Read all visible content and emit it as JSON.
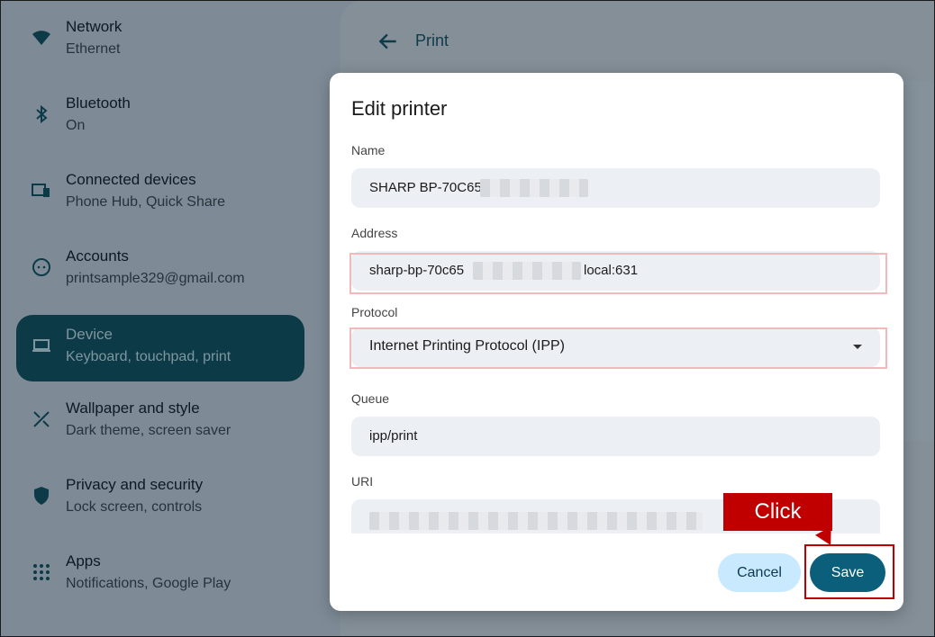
{
  "sidebar": {
    "items": [
      {
        "title": "Network",
        "subtitle": "Ethernet",
        "icon": "wifi-icon"
      },
      {
        "title": "Bluetooth",
        "subtitle": "On",
        "icon": "bluetooth-icon"
      },
      {
        "title": "Connected devices",
        "subtitle": "Phone Hub, Quick Share",
        "icon": "connected-devices-icon"
      },
      {
        "title": "Accounts",
        "subtitle": "printsample329@gmail.com",
        "icon": "account-icon"
      },
      {
        "title": "Device",
        "subtitle": "Keyboard, touchpad, print",
        "icon": "laptop-icon",
        "active": true
      },
      {
        "title": "Wallpaper and style",
        "subtitle": "Dark theme, screen saver",
        "icon": "palette-icon"
      },
      {
        "title": "Privacy and security",
        "subtitle": "Lock screen, controls",
        "icon": "shield-icon"
      },
      {
        "title": "Apps",
        "subtitle": "Notifications, Google Play",
        "icon": "apps-grid-icon"
      }
    ]
  },
  "main": {
    "title": "Print",
    "back_icon": "back-arrow-icon"
  },
  "dialog": {
    "title": "Edit printer",
    "name": {
      "label": "Name",
      "value": "SHARP BP-70C65"
    },
    "address": {
      "label": "Address",
      "value_prefix": "sharp-bp-70c65",
      "value_suffix": "local:631"
    },
    "protocol": {
      "label": "Protocol",
      "value": "Internet Printing Protocol (IPP)"
    },
    "queue": {
      "label": "Queue",
      "value": "ipp/print"
    },
    "uri": {
      "label": "URI"
    },
    "cancel_label": "Cancel",
    "save_label": "Save"
  },
  "annotation": {
    "click_label": "Click"
  },
  "colors": {
    "accent": "#0b5f7a",
    "highlight": "#c00000"
  }
}
